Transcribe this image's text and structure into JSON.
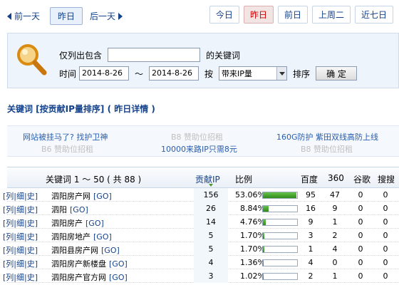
{
  "nav": {
    "prev_day": "前一天",
    "yesterday": "昨日",
    "next_day": "后一天",
    "date_buttons": [
      "今日",
      "昨日",
      "前日",
      "上周二",
      "近七日"
    ],
    "selected": "昨日"
  },
  "search": {
    "only_contains_label": "仅列出包含",
    "keyword_value": "",
    "keyword_suffix": "的关键词",
    "time_label": "时间",
    "start_date": "2014-8-26",
    "range_sep": "～",
    "end_date": "2014-8-26",
    "by_label": "按",
    "sort_select_value": "带来IP量",
    "sort_label": "排序",
    "ok_label": "确 定"
  },
  "section_title": "关键词 [按贡献IP量排序] ( 昨日详情 )",
  "ads": {
    "a1": "网站被挂马了? 找护卫神",
    "a2": "B8 赞助位招租",
    "a3": "160G防护 紫田双线高防上线",
    "a4": "B6 赞助位招租",
    "a5": "10000来路IP只需8元",
    "a6": "B8 赞助位招租"
  },
  "table": {
    "headers": {
      "keyword": "关键词 1 ～ 50 ( 共 88 )",
      "ip": "贡献IP",
      "ratio": "比例",
      "baidu": "百度",
      "s360": "360",
      "google": "谷歌",
      "sogou": "搜搜"
    },
    "link_list": "列",
    "link_detail": "细",
    "link_history": "史",
    "go_label": "[GO]",
    "rows": [
      {
        "keyword": "泗阳房产网",
        "ip": "156",
        "pct": "53.06%",
        "ratio": 53.06,
        "baidu": "95",
        "s360": "47",
        "google": "0",
        "sogou": "0"
      },
      {
        "keyword": "泗阳",
        "ip": "26",
        "pct": "8.84%",
        "ratio": 8.84,
        "baidu": "16",
        "s360": "9",
        "google": "0",
        "sogou": "0"
      },
      {
        "keyword": "泗阳房产",
        "ip": "14",
        "pct": "4.76%",
        "ratio": 4.76,
        "baidu": "9",
        "s360": "1",
        "google": "0",
        "sogou": "0"
      },
      {
        "keyword": "泗阳房地产",
        "ip": "5",
        "pct": "1.70%",
        "ratio": 1.7,
        "baidu": "3",
        "s360": "2",
        "google": "0",
        "sogou": "0"
      },
      {
        "keyword": "泗阳县房产网",
        "ip": "5",
        "pct": "1.70%",
        "ratio": 1.7,
        "baidu": "1",
        "s360": "4",
        "google": "0",
        "sogou": "0"
      },
      {
        "keyword": "泗阳房产新楼盘",
        "ip": "4",
        "pct": "1.36%",
        "ratio": 1.36,
        "baidu": "4",
        "s360": "0",
        "google": "0",
        "sogou": "0"
      },
      {
        "keyword": "泗阳房产官方网",
        "ip": "3",
        "pct": "1.02%",
        "ratio": 1.02,
        "baidu": "2",
        "s360": "1",
        "google": "0",
        "sogou": "0"
      }
    ]
  },
  "colors": {
    "link": "#15428b",
    "selected_red": "#cc0000",
    "bar_green": "#2f8a1b"
  }
}
